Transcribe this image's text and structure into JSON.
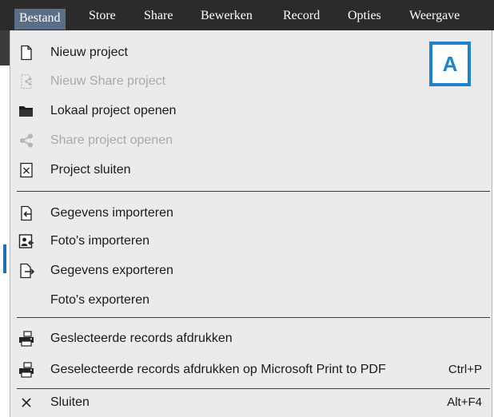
{
  "menubar": {
    "items": [
      "Bestand",
      "Store",
      "Share",
      "Bewerken",
      "Record",
      "Opties",
      "Weergave"
    ]
  },
  "callout": "A",
  "menu": {
    "items": [
      {
        "label": "Nieuw project",
        "icon": "new-file-icon",
        "disabled": false
      },
      {
        "label": "Nieuw Share project",
        "icon": "new-share-project-icon",
        "disabled": true
      },
      {
        "label": "Lokaal project openen",
        "icon": "folder-open-icon",
        "disabled": false
      },
      {
        "label": "Share project openen",
        "icon": "share-icon",
        "disabled": true
      },
      {
        "label": "Project sluiten",
        "icon": "close-project-icon",
        "disabled": false
      },
      {
        "label": "Gegevens importeren",
        "icon": "import-data-icon",
        "disabled": false
      },
      {
        "label": "Foto's importeren",
        "icon": "import-photo-icon",
        "disabled": false
      },
      {
        "label": "Gegevens exporteren",
        "icon": "export-data-icon",
        "disabled": false
      },
      {
        "label": "Foto's exporteren",
        "icon": "",
        "disabled": false
      },
      {
        "label": "Geslecteerde records afdrukken",
        "icon": "printer-icon",
        "disabled": false
      },
      {
        "label": "Geselecteerde records afdrukken op Microsoft Print to PDF",
        "icon": "printer-icon",
        "disabled": false,
        "shortcut": "Ctrl+P"
      },
      {
        "label": "Sluiten",
        "icon": "close-icon",
        "disabled": false,
        "shortcut": "Alt+F4"
      }
    ]
  },
  "colors": {
    "menubar_bg": "#2b2b2b",
    "active_menu_bg": "#5a6e86",
    "dropdown_bg": "#ebebeb",
    "disabled_text": "#a9a9a9",
    "callout_border": "#1f83c9"
  }
}
